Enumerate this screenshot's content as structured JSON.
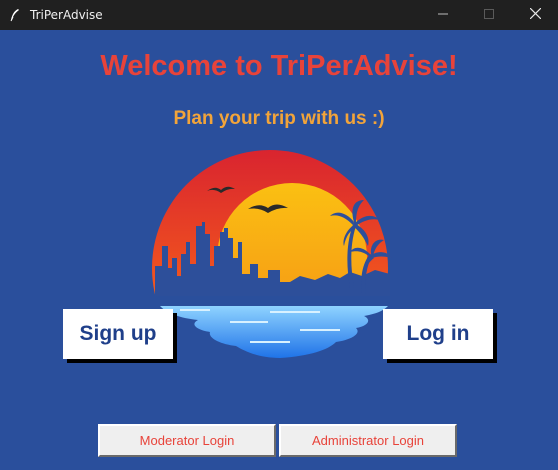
{
  "window": {
    "title": "TriPerAdvise",
    "icon": "feather-icon",
    "controls": [
      "minimize-icon",
      "maximize-icon",
      "close-icon"
    ]
  },
  "main": {
    "welcome_title": "Welcome to TriPerAdvise!",
    "subtitle": "Plan your trip with us :)",
    "logo": "sunset-city-palm-logo"
  },
  "buttons": {
    "signup_label": "Sign up",
    "login_label": "Log in",
    "moderator_login_label": "Moderator Login",
    "administrator_login_label": "Administrator Login"
  },
  "colors": {
    "background": "#2a4f9c",
    "title_text": "#e8433a",
    "subtitle_text": "#f2a43a",
    "main_button_text": "#1f3f8a",
    "small_button_text": "#e8433a"
  }
}
